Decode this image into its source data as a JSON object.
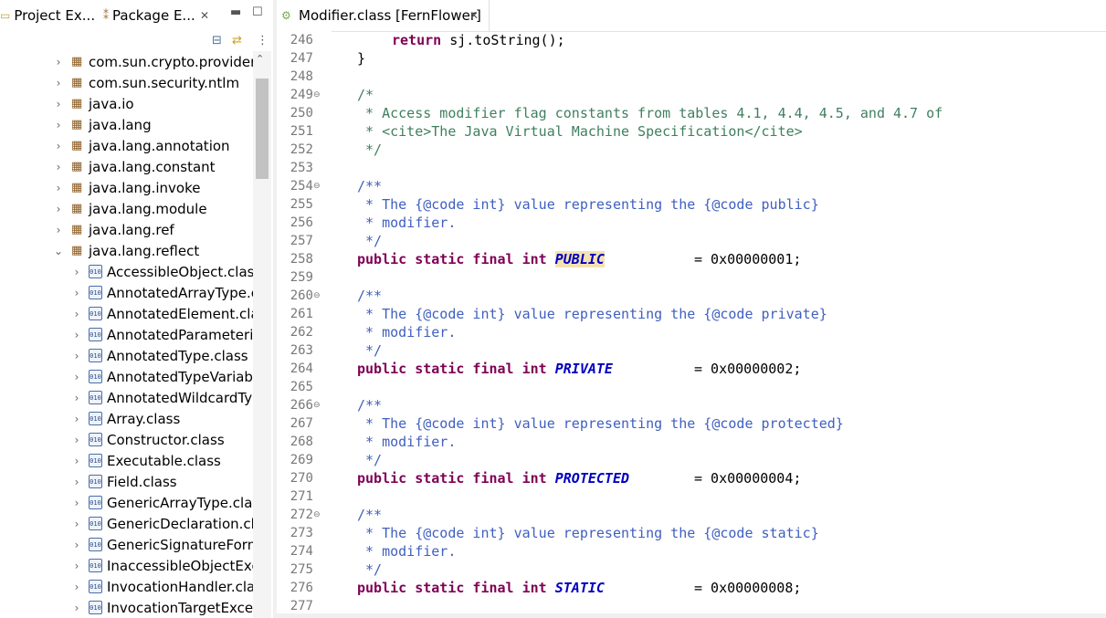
{
  "left_tabs": {
    "project_explorer": "Project Ex...",
    "package_explorer": "Package E..."
  },
  "tree": {
    "packages": [
      "com.sun.crypto.provider",
      "com.sun.security.ntlm",
      "java.io",
      "java.lang",
      "java.lang.annotation",
      "java.lang.constant",
      "java.lang.invoke",
      "java.lang.module",
      "java.lang.ref",
      "java.lang.reflect"
    ],
    "classes": [
      "AccessibleObject.class",
      "AnnotatedArrayType.cla",
      "AnnotatedElement.class",
      "AnnotatedParameterize",
      "AnnotatedType.class",
      "AnnotatedTypeVariable",
      "AnnotatedWildcardType",
      "Array.class",
      "Constructor.class",
      "Executable.class",
      "Field.class",
      "GenericArrayType.class",
      "GenericDeclaration.clas",
      "GenericSignatureForma",
      "InaccessibleObjectExcep",
      "InvocationHandler.class",
      "InvocationTargetExcept"
    ]
  },
  "editor": {
    "tab_title": "Modifier.class [FernFlower]",
    "line_numbers": [
      "246",
      "247",
      "248",
      "249",
      "250",
      "251",
      "252",
      "253",
      "254",
      "255",
      "256",
      "257",
      "258",
      "259",
      "260",
      "261",
      "262",
      "263",
      "264",
      "265",
      "266",
      "267",
      "268",
      "269",
      "270",
      "271",
      "272",
      "273",
      "274",
      "275",
      "276",
      "277"
    ],
    "folded_lines": [
      "249",
      "254",
      "260",
      "266",
      "272"
    ],
    "code": {
      "l246_kw": "return",
      "l246_rest": " sj.toString();",
      "l247": "}",
      "l249": "/*",
      "l250": " * Access modifier flag constants from tables 4.1, 4.4, 4.5, and 4.7 of",
      "l251": " * <cite>The Java Virtual Machine Specification</cite>",
      "l252": " */",
      "jd_open": "/**",
      "jd_close": " */",
      "jd_modifier": " * modifier.",
      "l255": " * The {@code int} value representing the {@code public}",
      "l261": " * The {@code int} value representing the {@code private}",
      "l267": " * The {@code int} value representing the {@code protected}",
      "l273": " * The {@code int} value representing the {@code static}",
      "decl_kw": "public static final int",
      "public_name": "PUBLIC",
      "public_val": "= 0x00000001;",
      "private_name": "PRIVATE",
      "private_val": "= 0x00000002;",
      "protected_name": "PROTECTED",
      "protected_val": "= 0x00000004;",
      "static_name": "STATIC",
      "static_val": "= 0x00000008;"
    }
  }
}
